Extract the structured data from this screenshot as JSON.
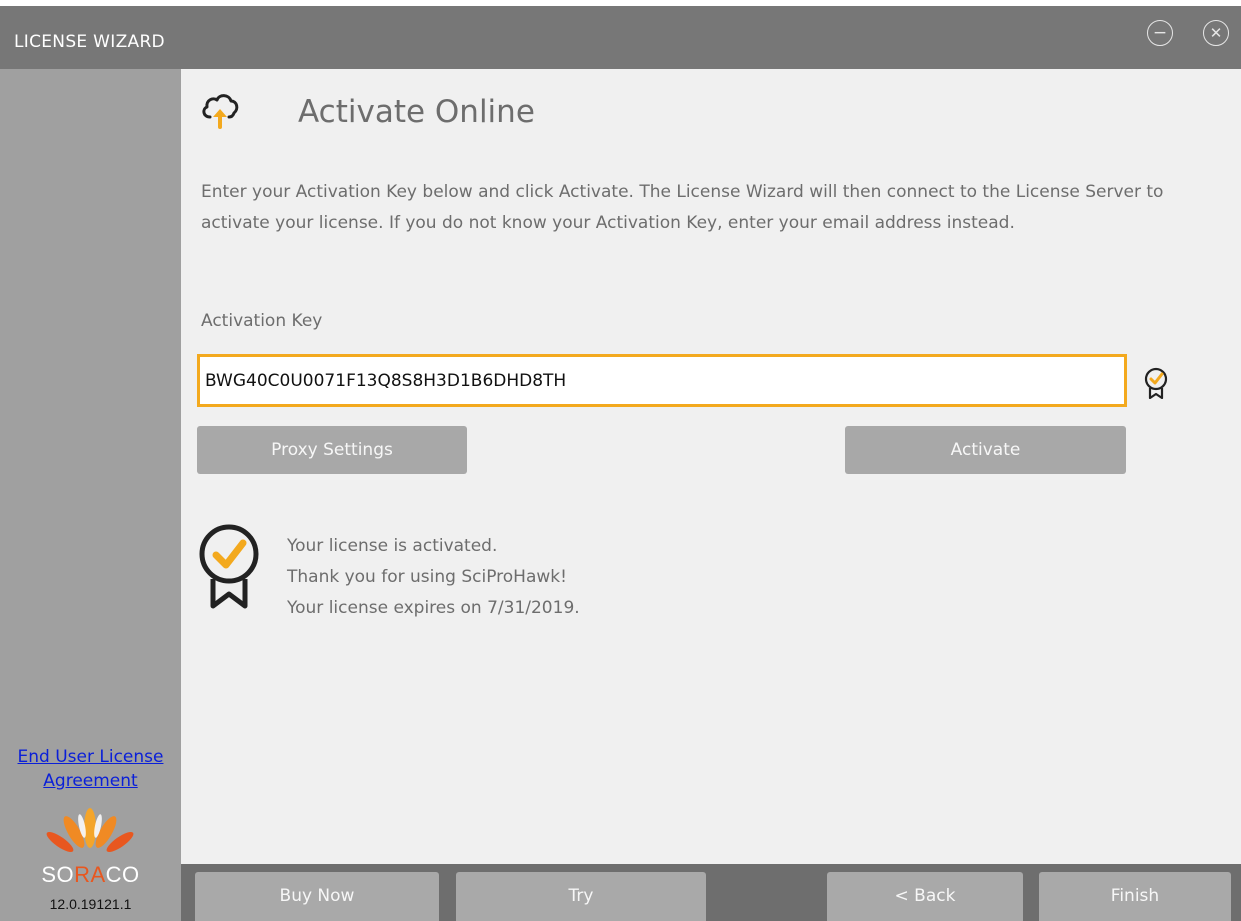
{
  "window": {
    "title": "LICENSE WIZARD",
    "minimize_icon": "minimize-circle-icon",
    "close_icon": "close-circle-icon"
  },
  "sidebar": {
    "eula_link": "End User License Agreement",
    "brand": {
      "so": "SO",
      "ra": "RA",
      "co": "CO"
    },
    "version": "12.0.19121.1",
    "colors": {
      "background": "#a0a0a0",
      "link": "#0a1fd8",
      "brand_accent": "#e8571f"
    }
  },
  "main": {
    "header_icon": "cloud-upload-icon",
    "title": "Activate Online",
    "description": "Enter your Activation Key below and click Activate. The License Wizard will then connect to the License Server to activate your license. If you do not know your Activation Key, enter your email address instead.",
    "activation_key_label": "Activation Key",
    "activation_key_value": "BWG40C0U0071F13Q8S8H3D1B6DHD8TH",
    "key_valid_icon": "verified-badge-icon",
    "proxy_settings_label": "Proxy Settings",
    "activate_label": "Activate",
    "status_icon": "verified-badge-icon",
    "status_lines": [
      "Your license is activated.",
      "Thank you for using SciProHawk!",
      "Your license expires on 7/31/2019."
    ],
    "colors": {
      "accent": "#f3a91e",
      "text": "#6d6d6d"
    }
  },
  "footer": {
    "buy_now_label": "Buy Now",
    "try_label": "Try",
    "back_label": "< Back",
    "finish_label": "Finish"
  }
}
